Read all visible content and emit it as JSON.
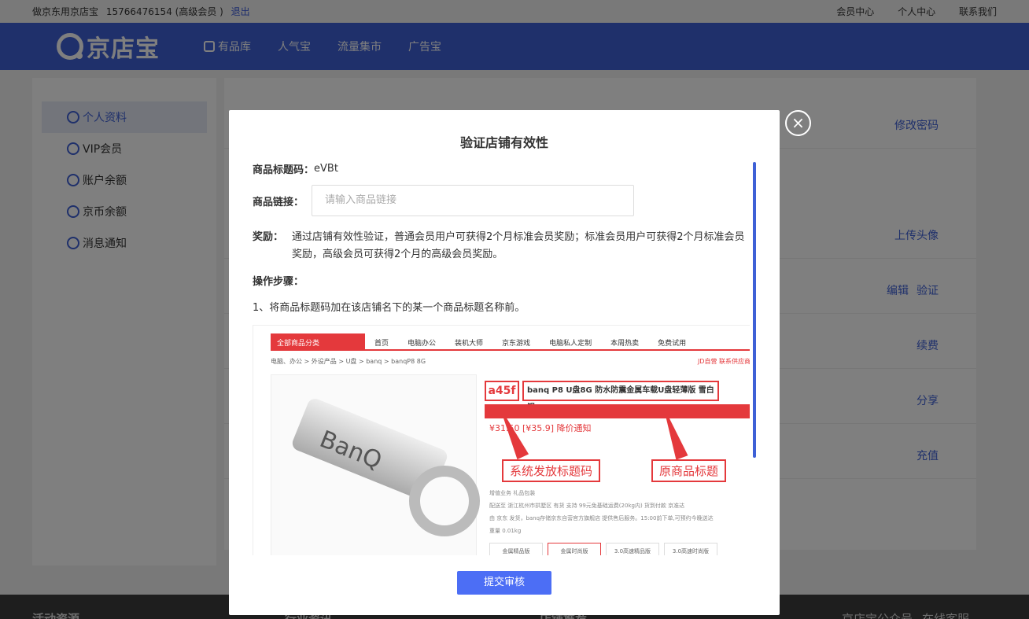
{
  "topbar": {
    "site_tag": "做京东用京店宝",
    "user": "15766476154 (高级会员 )",
    "logout": "退出",
    "links": [
      "会员中心",
      "个人中心",
      "联系我们"
    ]
  },
  "header": {
    "logo_text": "京店宝",
    "nav": [
      "有品库",
      "人气宝",
      "流量集市",
      "广告宝"
    ]
  },
  "sidebar": {
    "items": [
      {
        "label": "个人资料",
        "icon": "user-icon",
        "active": true
      },
      {
        "label": "VIP会员",
        "icon": "diamond-icon",
        "active": false
      },
      {
        "label": "账户余额",
        "icon": "wallet-icon",
        "active": false
      },
      {
        "label": "京币余额",
        "icon": "coin-icon",
        "active": false
      },
      {
        "label": "消息通知",
        "icon": "message-icon",
        "active": false
      }
    ]
  },
  "main": {
    "row1_link": "修改密码",
    "row2_link": "上传头像",
    "row3_link_a": "编辑",
    "row3_link_b": "验证",
    "row4_link": "续费",
    "row5_link": "分享",
    "row6_link": "充值"
  },
  "footer": {
    "cols": [
      "活动资源",
      "行业资讯",
      "店铺推荐",
      "京店宝公众号",
      "在线客服"
    ]
  },
  "modal": {
    "title": "验证店铺有效性",
    "code_label": "商品标题码：",
    "code_value": "eVBt",
    "link_label": "商品链接：",
    "link_placeholder": "请输入商品链接",
    "reward_label": "奖励：",
    "reward_text": "通过店铺有效性验证，普通会员用户可获得2个月标准会员奖励；标准会员用户可获得2个月标准会员奖励，高级会员可获得2个月的高级会员奖励。",
    "steps_title": "操作步骤：",
    "step1": "1、将商品标题码加在该店铺名下的某一个商品标题名称前。",
    "submit": "提交审核",
    "close": "×"
  },
  "illustration": {
    "category": "全部商品分类",
    "nav": [
      "首页",
      "电脑办公",
      "装机大师",
      "京东游戏",
      "电脑私人定制",
      "本周热卖",
      "免费试用"
    ],
    "crumb": "电脑、办公 > 外设产品 > U盘 > banq > banqP8 8G",
    "jd_tag": "JD自营  联系供应商",
    "usb_brand": "BanQ",
    "code": "a45f",
    "product_title": "banq P8 U盘8G 防水防震金属车载U盘轻薄版 雪白银",
    "price": "¥31.50  [¥35.9] 降价通知",
    "annotation_code": "系统发放标题码",
    "annotation_title": "原商品标题",
    "details": [
      "增值业务  礼品包装",
      "配送至  浙江杭州市拱墅区  有货  支持  99元免基础运费(20kg内)  货到付款  京准达",
      "由 京东 发货，banq存储京东自营官方旗舰店 提供售后服务。15:00前下单,可预约今晚送达",
      "重量  0.01kg"
    ],
    "variants": [
      "金属精品版",
      "金属时尚版",
      "3.0高速精品版",
      "3.0高速时尚版"
    ]
  }
}
